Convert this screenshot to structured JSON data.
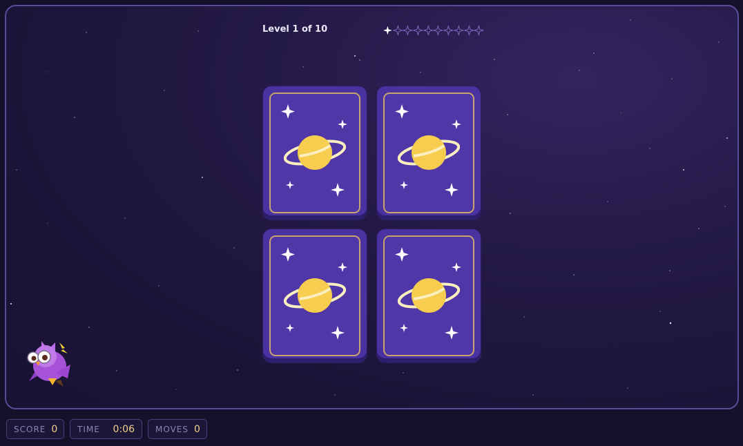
{
  "game": {
    "level_text": "Level 1 of 10",
    "level_progress": {
      "completed": 1,
      "total": 10
    }
  },
  "cards": [
    {
      "state": "face-down",
      "back_icon": "planet-icon"
    },
    {
      "state": "face-down",
      "back_icon": "planet-icon"
    },
    {
      "state": "face-down",
      "back_icon": "planet-icon"
    },
    {
      "state": "face-down",
      "back_icon": "planet-icon"
    }
  ],
  "mascot": {
    "icon": "owl-mascot-icon"
  },
  "stats": {
    "score_label": "SCORE",
    "score_value": "0",
    "time_label": "TIME",
    "time_value": "0:06",
    "moves_label": "MOVES",
    "moves_value": "0"
  },
  "colors": {
    "card_back": "#4a32a0",
    "card_border": "#c9a46c",
    "planet": "#f6cd4f",
    "stat_value": "#f3d487",
    "progress_star": "#7e6fc4"
  }
}
